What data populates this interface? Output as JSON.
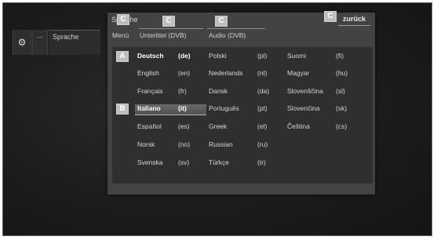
{
  "sidebar": {
    "gear_icon": "gear-icon",
    "dots_label": "...",
    "sprache_label": "Sprache"
  },
  "dialog": {
    "title": "Sprache",
    "back_label": "zurück",
    "tabs": [
      {
        "label": "Menü"
      },
      {
        "label": "Untertitel (DVB)"
      },
      {
        "label": "Audio (DVB)"
      }
    ],
    "callouts": [
      "C",
      "C",
      "C",
      "C",
      "A",
      "B"
    ]
  },
  "languages": [
    {
      "name": "Deutsch",
      "code": "(de)",
      "selected": true
    },
    {
      "name": "English",
      "code": "(en)"
    },
    {
      "name": "Français",
      "code": "(fr)"
    },
    {
      "name": "Italiano",
      "code": "(it)",
      "highlighted": true
    },
    {
      "name": "Español",
      "code": "(es)"
    },
    {
      "name": "Norsk",
      "code": "(no)"
    },
    {
      "name": "Svenska",
      "code": "(sv)"
    },
    {
      "name": "Polski",
      "code": "(pl)"
    },
    {
      "name": "Nederlands",
      "code": "(nl)"
    },
    {
      "name": "Dansk",
      "code": "(da)"
    },
    {
      "name": "Português",
      "code": "(pt)"
    },
    {
      "name": "Greek",
      "code": "(el)"
    },
    {
      "name": "Russian",
      "code": "(ru)"
    },
    {
      "name": "Türkçe",
      "code": "(tr)"
    },
    {
      "name": "Suomi",
      "code": "(fi)"
    },
    {
      "name": "Magyar",
      "code": "(hu)"
    },
    {
      "name": "Slovenščina",
      "code": "(sl)"
    },
    {
      "name": "Slovenčina",
      "code": "(sk)"
    },
    {
      "name": "Čeština",
      "code": "(cs)"
    }
  ]
}
